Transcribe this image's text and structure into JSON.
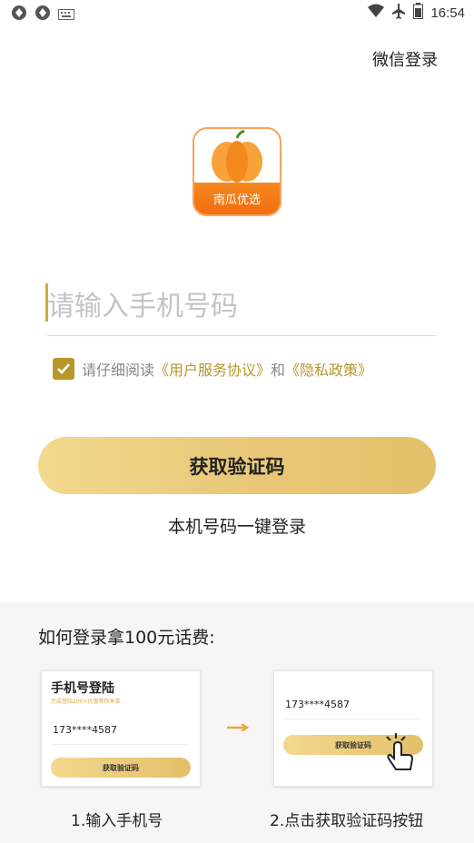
{
  "status_bar": {
    "time": "16:54",
    "left_icons": [
      "app-icon",
      "app-icon",
      "keyboard-icon"
    ],
    "right_icons": [
      "wifi-icon",
      "airplane-icon",
      "battery-icon"
    ]
  },
  "header": {
    "wechat_login": "微信登录"
  },
  "logo": {
    "name": "南瓜优选",
    "brand_color": "#f26b0f"
  },
  "form": {
    "phone_placeholder": "请输入手机号码",
    "agreement_prefix": "请仔细阅读",
    "user_agreement": "《用户服务协议》",
    "and": "和",
    "privacy_policy": "《隐私政策》",
    "agreement_checked": true,
    "get_code_button": "获取验证码",
    "one_click_login": "本机号码一键登录",
    "accent_color": "#b8962a"
  },
  "guide": {
    "title": "如何登录拿100元话费:",
    "card1": {
      "title": "手机号登陆",
      "subtitle": "完成登陆200+优惠等你来拿",
      "phone": "173****4587",
      "button": "获取验证码"
    },
    "card2": {
      "phone": "173****4587",
      "button": "获取验证码"
    },
    "step1_label": "1.输入手机号",
    "step2_label": "2.点击获取验证码按钮"
  }
}
